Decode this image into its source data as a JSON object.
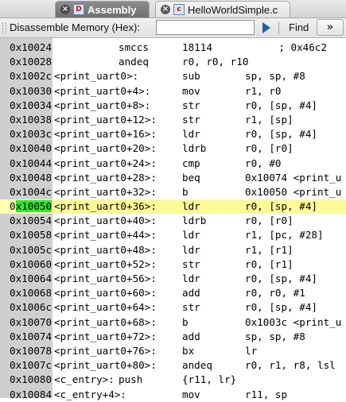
{
  "tabs": [
    {
      "label": "Assembly",
      "active": true
    },
    {
      "label": "HelloWorldSimple.c",
      "active": false
    }
  ],
  "toolbar": {
    "label": "Disassemble Memory (Hex):",
    "input_value": "",
    "find_label": "Find",
    "more_label": "»"
  },
  "current_address": "0x10050",
  "rows": [
    {
      "addr": "0x10024",
      "label": "",
      "mnem": "smccs",
      "ops": "18114           ; 0x46c2",
      "kind": "data"
    },
    {
      "addr": "0x10028",
      "label": "",
      "mnem": "andeq",
      "ops": "r0, r0, r10",
      "kind": "data"
    },
    {
      "addr": "0x1002c",
      "label": "<print_uart0>:",
      "mnem": "sub",
      "ops": "sp, sp, #8",
      "kind": "code"
    },
    {
      "addr": "0x10030",
      "label": "<print_uart0+4>:",
      "mnem": "mov",
      "ops": "r1, r0",
      "kind": "code"
    },
    {
      "addr": "0x10034",
      "label": "<print_uart0+8>:",
      "mnem": "str",
      "ops": "r0, [sp, #4]",
      "kind": "code"
    },
    {
      "addr": "0x10038",
      "label": "<print_uart0+12>:",
      "mnem": "str",
      "ops": "r1, [sp]",
      "kind": "code"
    },
    {
      "addr": "0x1003c",
      "label": "<print_uart0+16>:",
      "mnem": "ldr",
      "ops": "r0, [sp, #4]",
      "kind": "code"
    },
    {
      "addr": "0x10040",
      "label": "<print_uart0+20>:",
      "mnem": "ldrb",
      "ops": "r0, [r0]",
      "kind": "code"
    },
    {
      "addr": "0x10044",
      "label": "<print_uart0+24>:",
      "mnem": "cmp",
      "ops": "r0, #0",
      "kind": "code"
    },
    {
      "addr": "0x10048",
      "label": "<print_uart0+28>:",
      "mnem": "beq",
      "ops": "0x10074 <print_u",
      "kind": "code"
    },
    {
      "addr": "0x1004c",
      "label": "<print_uart0+32>:",
      "mnem": "b",
      "ops": "0x10050 <print_u",
      "kind": "code"
    },
    {
      "addr": "0x10050",
      "label": "<print_uart0+36>:",
      "mnem": "ldr",
      "ops": "r0, [sp, #4]",
      "kind": "current"
    },
    {
      "addr": "0x10054",
      "label": "<print_uart0+40>:",
      "mnem": "ldrb",
      "ops": "r0, [r0]",
      "kind": "code"
    },
    {
      "addr": "0x10058",
      "label": "<print_uart0+44>:",
      "mnem": "ldr",
      "ops": "r1, [pc, #28]",
      "kind": "code"
    },
    {
      "addr": "0x1005c",
      "label": "<print_uart0+48>:",
      "mnem": "ldr",
      "ops": "r1, [r1]",
      "kind": "code"
    },
    {
      "addr": "0x10060",
      "label": "<print_uart0+52>:",
      "mnem": "str",
      "ops": "r0, [r1]",
      "kind": "code"
    },
    {
      "addr": "0x10064",
      "label": "<print_uart0+56>:",
      "mnem": "ldr",
      "ops": "r0, [sp, #4]",
      "kind": "code"
    },
    {
      "addr": "0x10068",
      "label": "<print_uart0+60>:",
      "mnem": "add",
      "ops": "r0, r0, #1",
      "kind": "code"
    },
    {
      "addr": "0x1006c",
      "label": "<print_uart0+64>:",
      "mnem": "str",
      "ops": "r0, [sp, #4]",
      "kind": "code"
    },
    {
      "addr": "0x10070",
      "label": "<print_uart0+68>:",
      "mnem": "b",
      "ops": "0x1003c <print_u",
      "kind": "code"
    },
    {
      "addr": "0x10074",
      "label": "<print_uart0+72>:",
      "mnem": "add",
      "ops": "sp, sp, #8",
      "kind": "code"
    },
    {
      "addr": "0x10078",
      "label": "<print_uart0+76>:",
      "mnem": "bx",
      "ops": "lr",
      "kind": "code"
    },
    {
      "addr": "0x1007c",
      "label": "<print_uart0+80>:",
      "mnem": "andeq",
      "ops": "r0, r1, r8, lsl",
      "kind": "code"
    },
    {
      "addr": "0x10080",
      "label": "<c_entry>:",
      "mnem": "push",
      "ops": "{r11, lr}",
      "kind": "entry"
    },
    {
      "addr": "0x10084",
      "label": "<c_entry+4>:",
      "mnem": "mov",
      "ops": "r11, sp",
      "kind": "code"
    }
  ]
}
